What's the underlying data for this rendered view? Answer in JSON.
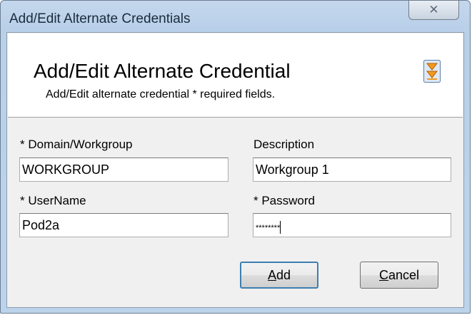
{
  "window": {
    "title": "Add/Edit Alternate Credentials",
    "close_glyph": "✕"
  },
  "header": {
    "title": "Add/Edit Alternate Credential",
    "subtitle": "Add/Edit alternate credential * required fields.",
    "collapse_icon": "double-arrow-collapse-icon"
  },
  "form": {
    "domain": {
      "label": "* Domain/Workgroup",
      "value": "WORKGROUP"
    },
    "description": {
      "label": "Description",
      "value": "Workgroup 1"
    },
    "username": {
      "label": "* UserName",
      "value": "Pod2a"
    },
    "password": {
      "label": "* Password",
      "value": "********"
    }
  },
  "buttons": {
    "add": {
      "mnemonic": "A",
      "rest": "dd"
    },
    "cancel": {
      "mnemonic": "C",
      "rest": "ancel"
    }
  },
  "colors": {
    "title_bar": "#b9d0e9",
    "client_bg": "#f0f0f0",
    "icon_orange": "#f39a1e",
    "default_button_border": "#3c7fb1"
  }
}
